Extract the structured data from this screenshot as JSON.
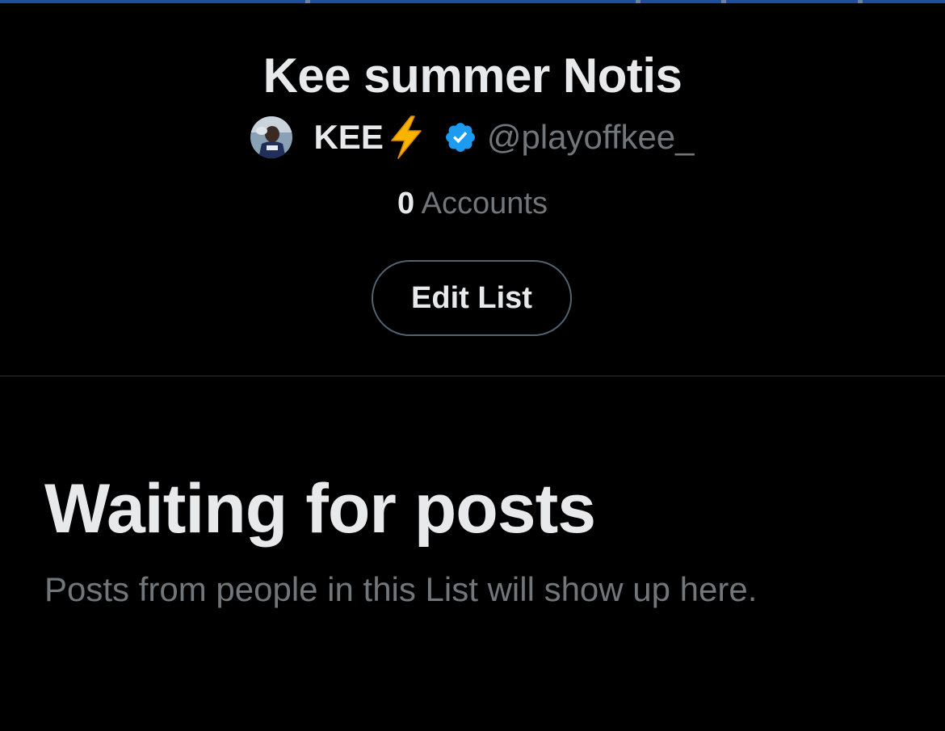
{
  "list": {
    "title": "Kee summer Notis",
    "owner_name": "KEE",
    "owner_emoji": "lightning-bolt",
    "owner_handle": "@playoffkee_",
    "verified": true,
    "accounts_count": "0",
    "accounts_label": "Accounts",
    "edit_button_label": "Edit List"
  },
  "empty_state": {
    "title": "Waiting for posts",
    "subtitle": "Posts from people in this List will show up here."
  },
  "colors": {
    "background": "#000000",
    "primary_text": "#e7e9ea",
    "secondary_text": "#71767b",
    "verified_blue": "#1d9bf0",
    "button_border": "#536471",
    "divider": "#2f3336",
    "bolt": "#f7b500"
  }
}
